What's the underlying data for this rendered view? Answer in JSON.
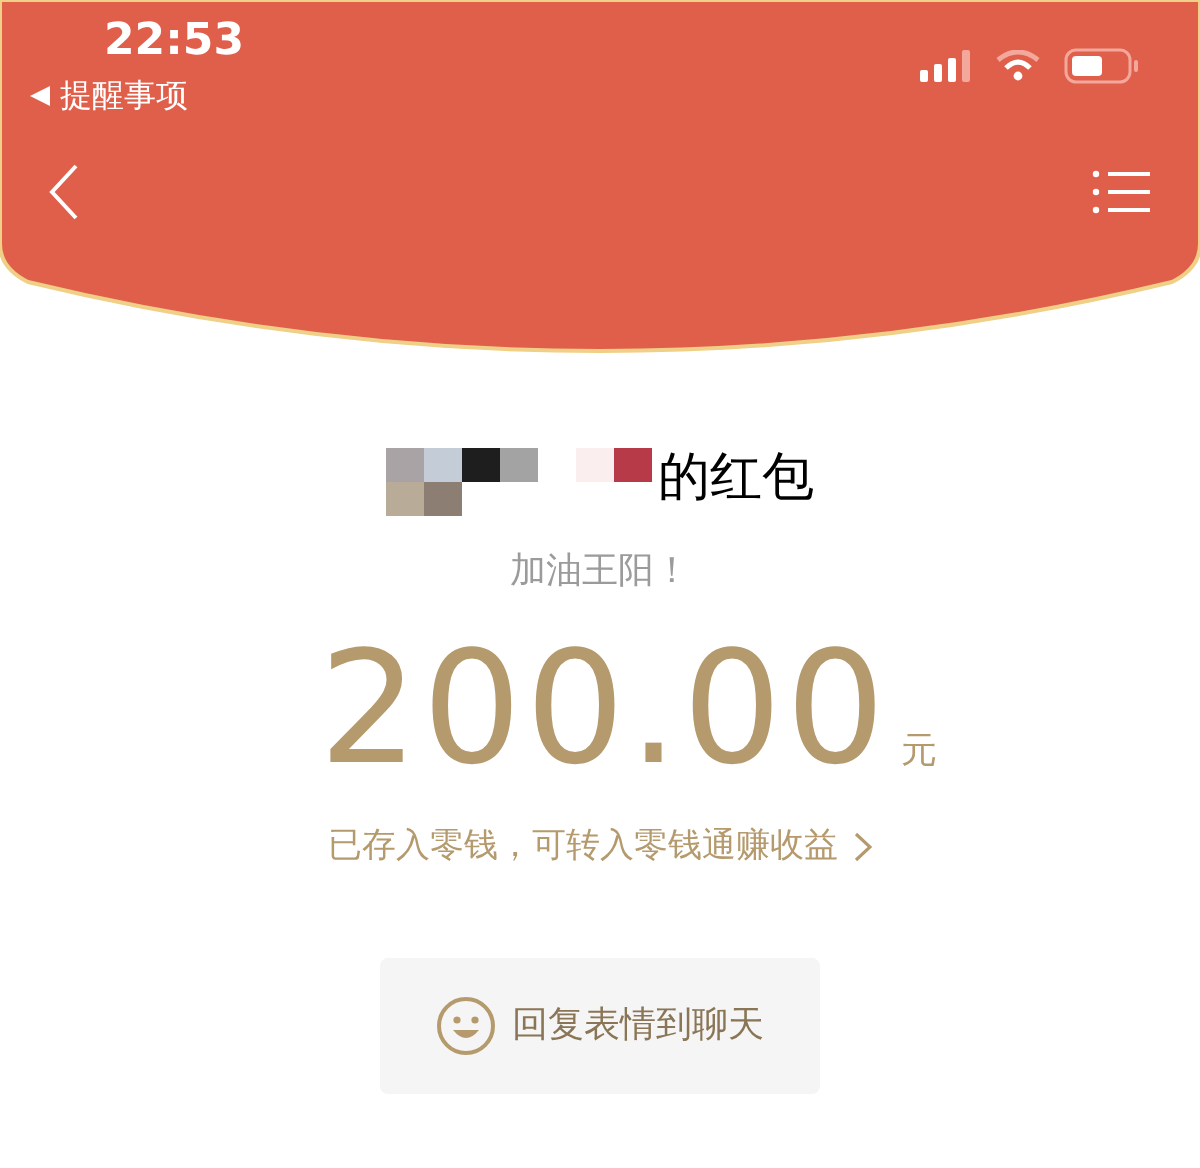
{
  "status_bar": {
    "time": "22:53",
    "back_label": "提醒事项"
  },
  "packet": {
    "sender_suffix": "的红包",
    "message": "加油王阳！",
    "amount": "200.00",
    "unit": "元",
    "note": "已存入零钱，可转入零钱通赚收益"
  },
  "reply_button": {
    "label": "回复表情到聊天"
  }
}
